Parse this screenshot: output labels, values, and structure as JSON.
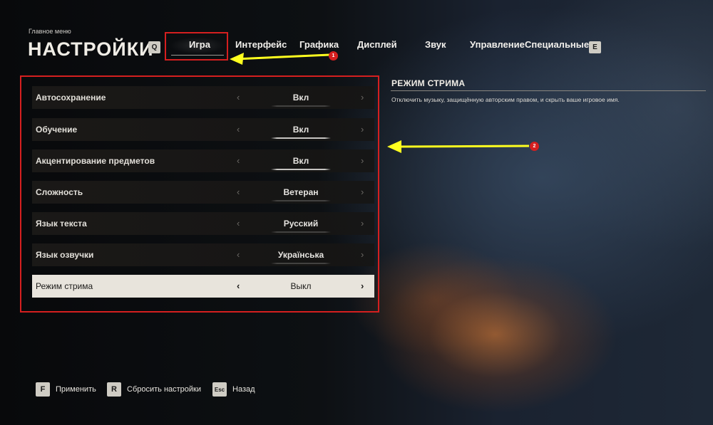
{
  "header": {
    "breadcrumb": "Главное меню",
    "title": "НАСТРОЙКИ",
    "prev_key": "Q",
    "next_key": "E"
  },
  "tabs": [
    {
      "label": "Игра",
      "active": true
    },
    {
      "label": "Интерфейс"
    },
    {
      "label": "Графика"
    },
    {
      "label": "Дисплей"
    },
    {
      "label": "Звук"
    },
    {
      "label": "Управление"
    },
    {
      "label": "Специальные"
    }
  ],
  "settings": [
    {
      "label": "Автосохранение",
      "value": "Вкл"
    },
    {
      "label": "Обучение",
      "value": "Вкл"
    },
    {
      "label": "Акцентирование предметов",
      "value": "Вкл"
    },
    {
      "label": "Сложность",
      "value": "Ветеран"
    },
    {
      "label": "Язык текста",
      "value": "Русский"
    },
    {
      "label": "Язык озвучки",
      "value": "Українська"
    },
    {
      "label": "Режим стрима",
      "value": "Выкл",
      "selected": true
    }
  ],
  "arrows": {
    "left": "‹",
    "right": "›"
  },
  "details": {
    "title": "РЕЖИМ СТРИМА",
    "description": "Отключить музыку, защищённую авторским правом, и скрыть ваше игровое имя."
  },
  "annotations": [
    "1",
    "2"
  ],
  "footer": [
    {
      "key": "F",
      "label": "Применить"
    },
    {
      "key": "R",
      "label": "Сбросить настройки"
    },
    {
      "key": "Esc",
      "label": "Назад"
    }
  ],
  "colors": {
    "annotation_box": "#d51f1f",
    "annotation_arrow": "#ffff1f",
    "selected_row": "#e8e4dc"
  }
}
